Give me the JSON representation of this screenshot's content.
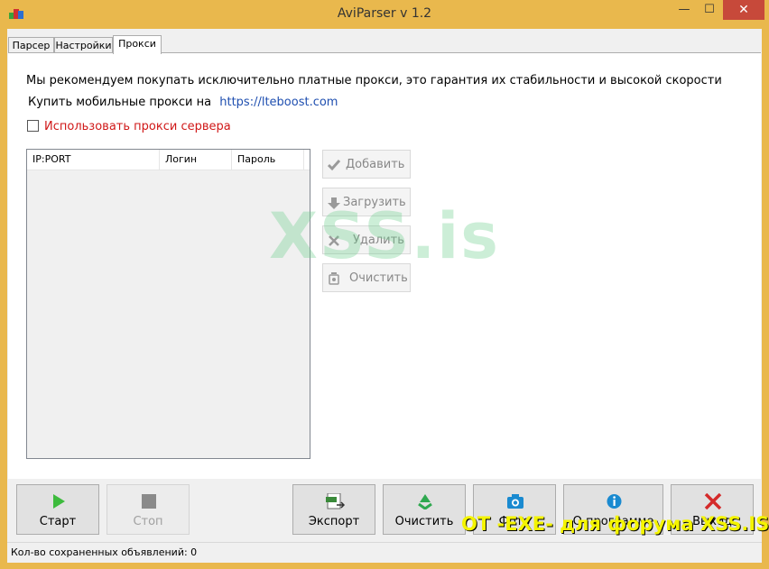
{
  "window": {
    "title": "AviParser v 1.2",
    "minimize": "—",
    "maximize": "☐",
    "close": "✕"
  },
  "tabs": [
    {
      "label": "Парсер"
    },
    {
      "label": "Настройки"
    },
    {
      "label": "Прокси",
      "active": true
    }
  ],
  "proxy": {
    "notice": "Мы рекомендуем покупать исключительно платные прокси, это гарантия их стабильности и высокой скорости",
    "buy_label": "Купить мобильные прокси на",
    "buy_link": "https://lteboost.com",
    "use_proxy_label": "Использовать прокси сервера",
    "use_proxy_checked": false,
    "columns": [
      "IP:PORT",
      "Логин",
      "Пароль"
    ],
    "rows": [],
    "buttons": {
      "add": "Добавить",
      "load": "Загрузить",
      "delete": "Удалить",
      "clear": "Очистить"
    }
  },
  "watermark": "XSS.is",
  "toolbar": {
    "start": "Старт",
    "stop": "Стоп",
    "export": "Экспорт",
    "clear": "Очистить",
    "photo": "Фото",
    "about": "О программе",
    "exit": "Выход"
  },
  "status": {
    "saved_count_label": "Кол-во сохраненных объявлений: 0"
  },
  "overlay_text": "ОТ -EXE- для форума XSS.IS",
  "colors": {
    "window_frame": "#e9b84d",
    "close_button": "#c7493a",
    "link": "#1f4fb0",
    "checkbox_label": "#d01818",
    "watermark": "#6fd08f",
    "overlay_text": "#f4f400"
  }
}
